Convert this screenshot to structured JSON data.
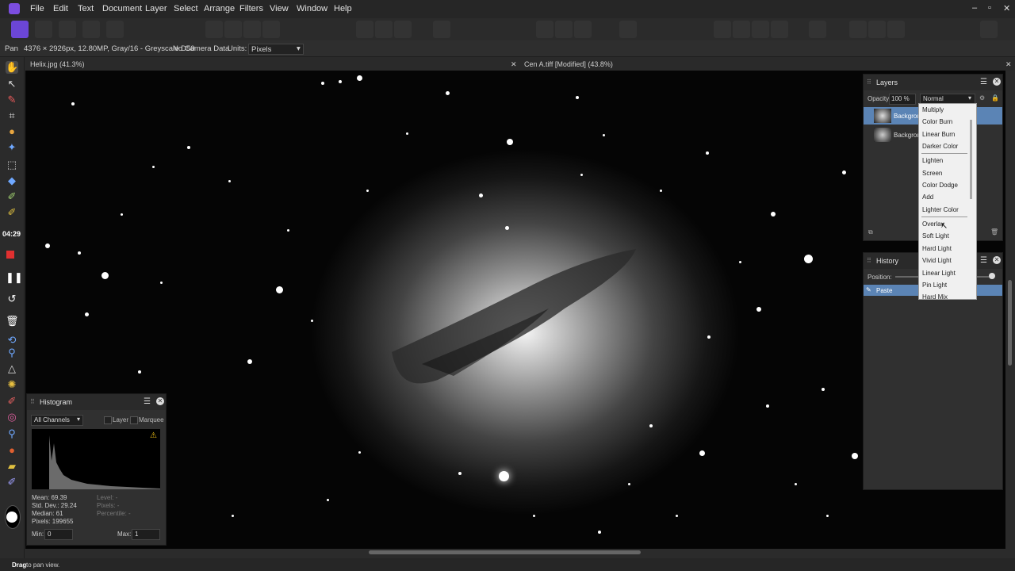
{
  "menu": [
    "File",
    "Edit",
    "Text",
    "Document",
    "Layer",
    "Select",
    "Arrange",
    "Filters",
    "View",
    "Window",
    "Help"
  ],
  "window_controls": {
    "minimize": "–",
    "restore": "▫",
    "close": "✕"
  },
  "context": {
    "tool": "Pan",
    "doc_info": "4376 × 2926px, 12.80MP, Gray/16 - Greyscale D50",
    "camera": "No Camera Data",
    "units_label": "Units:",
    "units_value": "Pixels"
  },
  "tabs": [
    {
      "label": "Helix.jpg (41.3%)",
      "close": "✕"
    },
    {
      "label": "Cen A.tiff [Modified] (43.8%)",
      "close": "✕"
    }
  ],
  "timer": "04:29",
  "status": {
    "bold": "Drag",
    "rest": " to pan view."
  },
  "layers_panel": {
    "title": "Layers",
    "opacity_label": "Opacity:",
    "opacity_value": "100 %",
    "blend_mode": "Normal",
    "layers": [
      {
        "name": "Backgrou"
      },
      {
        "name": "Backgrou"
      }
    ]
  },
  "blend_options": [
    "Multiply",
    "Color Burn",
    "Linear Burn",
    "Darker Color",
    "Lighten",
    "Screen",
    "Color Dodge",
    "Add",
    "Lighter Color",
    "Overlay",
    "Soft Light",
    "Hard Light",
    "Vivid Light",
    "Linear Light",
    "Pin Light",
    "Hard Mix"
  ],
  "history_panel": {
    "title": "History",
    "position_label": "Position:",
    "entries": [
      "Paste"
    ]
  },
  "histogram_panel": {
    "title": "Histogram",
    "channel": "All Channels",
    "layer_label": "Layer",
    "marquee_label": "Marquee",
    "stats_left": [
      "Mean: 69.39",
      "Std. Dev.: 29.24",
      "Median: 61",
      "Pixels: 199655"
    ],
    "stats_right": [
      "Level: -",
      "Pixels: -",
      "Percentile: -"
    ],
    "min_label": "Min:",
    "min_value": "0",
    "max_label": "Max:",
    "max_value": "1"
  },
  "colors": {
    "accent": "#4e8fe6",
    "selection": "#5b84b5",
    "warning": "#f2c318"
  }
}
